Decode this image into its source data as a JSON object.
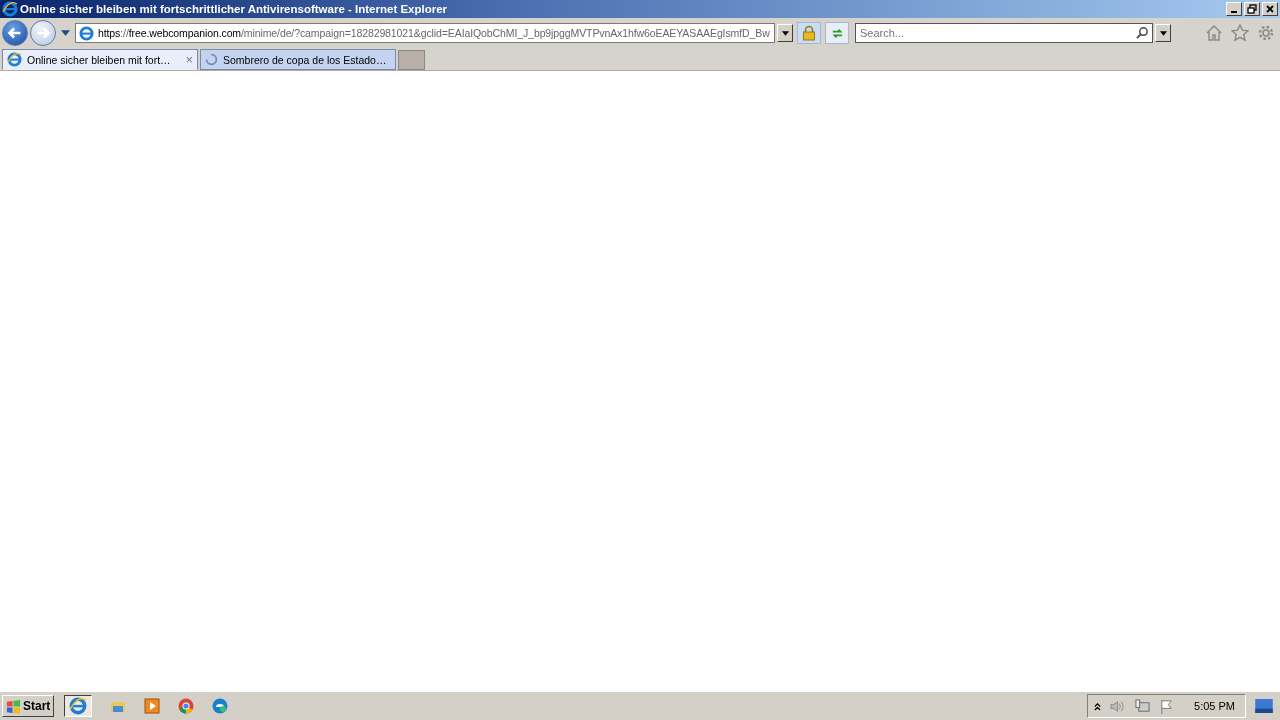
{
  "window": {
    "title": "Online sicher bleiben mit fortschrittlicher Antivirensoftware - Internet Explorer"
  },
  "address_bar": {
    "segments": [
      {
        "text": "https",
        "emphasis": true
      },
      {
        "text": "://",
        "emphasis": false
      },
      {
        "text": "free.webcompanion.com",
        "emphasis": true
      },
      {
        "text": "/minime/de/?campaign=18282981021&gclid=EAIaIQobChMI_J_bp9jpggMVTPvnAx1hfw6oEAEYASAAEgIsmfD_Bw",
        "emphasis": false
      }
    ]
  },
  "search": {
    "placeholder": "Search..."
  },
  "tabs": [
    {
      "label": "Online sicher bleiben mit fort…",
      "selected": true,
      "kind": "page",
      "close": "×"
    },
    {
      "label": "Sombrero de copa de los Estado…",
      "selected": false,
      "kind": "loading"
    }
  ],
  "taskbar": {
    "start": "Start",
    "clock": "5:05 PM"
  }
}
